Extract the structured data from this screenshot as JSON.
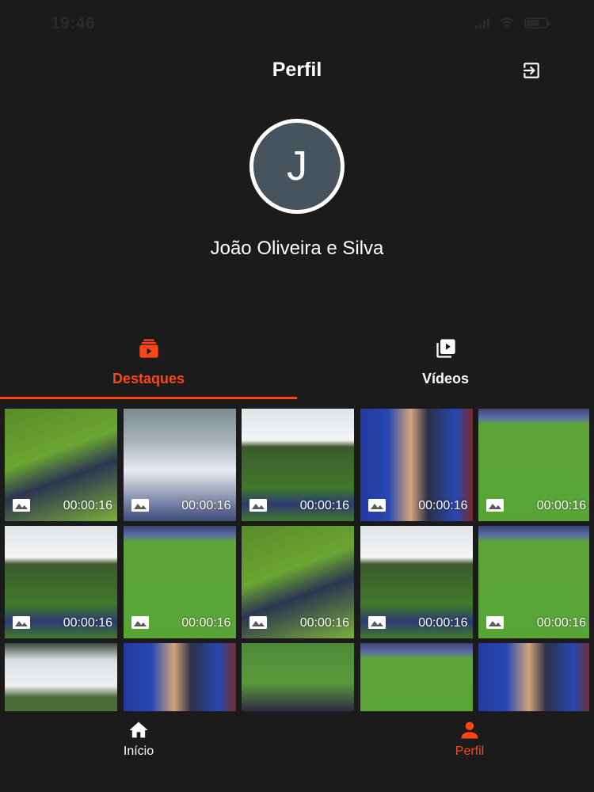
{
  "status_bar": {
    "time": "19:46"
  },
  "header": {
    "title": "Perfil",
    "logout_icon": "logout-icon"
  },
  "profile": {
    "initial": "J",
    "name": "João Oliveira e Silva"
  },
  "tabs": [
    {
      "label": "Destaques",
      "icon": "highlights-icon",
      "active": true
    },
    {
      "label": "Vídeos",
      "icon": "video-library-icon",
      "active": false
    }
  ],
  "thumbnails": [
    {
      "duration": "00:00:16",
      "scene": "player-closeup"
    },
    {
      "duration": "00:00:16",
      "scene": "player-white-kit"
    },
    {
      "duration": "00:00:16",
      "scene": "wide-field-scoreboard"
    },
    {
      "duration": "00:00:16",
      "scene": "redbull-player"
    },
    {
      "duration": "00:00:16",
      "scene": "top-field"
    },
    {
      "duration": "00:00:16",
      "scene": "wide-field-scoreboard"
    },
    {
      "duration": "00:00:16",
      "scene": "top-field"
    },
    {
      "duration": "00:00:16",
      "scene": "player-closeup"
    },
    {
      "duration": "00:00:16",
      "scene": "wide-field-scoreboard"
    },
    {
      "duration": "00:00:16",
      "scene": "top-field"
    },
    {
      "duration": "",
      "scene": "wide-field"
    },
    {
      "duration": "",
      "scene": "redbull-player"
    },
    {
      "duration": "",
      "scene": "team-huddle"
    },
    {
      "duration": "",
      "scene": "top-field"
    },
    {
      "duration": "",
      "scene": "redbull-player"
    }
  ],
  "bottom_nav": [
    {
      "label": "Início",
      "icon": "home-icon",
      "active": false
    },
    {
      "label": "Perfil",
      "icon": "profile-icon",
      "active": true
    }
  ],
  "colors": {
    "accent": "#ff4516",
    "background": "#1b1b1b",
    "avatar": "#47545d"
  }
}
